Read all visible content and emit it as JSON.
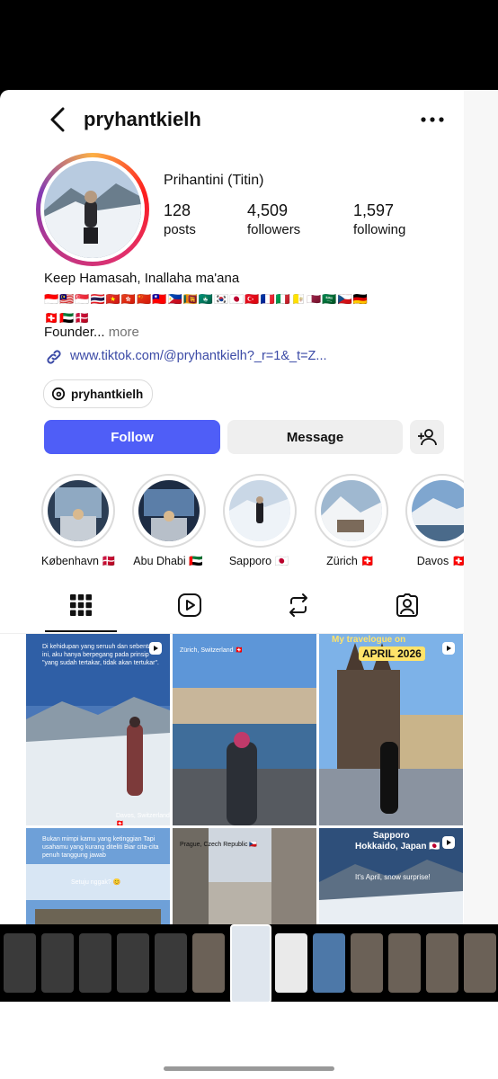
{
  "header": {
    "username": "pryhantkielh"
  },
  "profile": {
    "full_name": "Prihantini (Titin)",
    "stats": [
      {
        "value": "128",
        "label": "posts"
      },
      {
        "value": "4,509",
        "label": "followers"
      },
      {
        "value": "1,597",
        "label": "following"
      }
    ],
    "bio_line": "Keep Hamasah, Inallaha ma'ana",
    "flags_row1": "🇮🇩🇲🇾🇸🇬🇹🇭🇻🇳🇭🇰🇨🇳🇹🇼🇵🇭🇱🇰🇲🇴🇰🇷🇯🇵🇹🇷🇫🇷🇮🇹🇻🇦🇶🇦🇸🇦🇨🇿🇩🇪",
    "flags_row2": "🇨🇭🇦🇪🇩🇰",
    "founder": "Founder...",
    "more": "more",
    "link": "www.tiktok.com/@pryhantkielh?_r=1&_t=Z...",
    "threads_handle": "pryhantkielh"
  },
  "actions": {
    "follow": "Follow",
    "message": "Message"
  },
  "highlights": [
    {
      "label": "København 🇩🇰"
    },
    {
      "label": "Abu Dhabi 🇦🇪"
    },
    {
      "label": "Sapporo 🇯🇵"
    },
    {
      "label": "Zürich 🇨🇭"
    },
    {
      "label": "Davos 🇨🇭"
    }
  ],
  "grid": {
    "post1_text": "Di kehidupan yang seruuh dan sebentar ini, aku hanya berpegang pada prinsip \"yang sudah tertakar, tidak akan tertukar\".",
    "post1_caption": "Davos, Switzerland 🇨🇭",
    "post2_text": "Zürich, Switzerland 🇨🇭",
    "post3_banner": "My travelogue on",
    "post3_date": "APRIL 2026",
    "post4_text": "Bukan mimpi kamu yang ketinggian Tapi usahamu yang kurang diteliti Biar cita-cita penuh tanggung jawab",
    "post4_sub": "Setuju nggak? 😊",
    "post5_text": "Prague, Czech Republic 🇨🇿",
    "post6_title": "Sapporo",
    "post6_sub": "Hokkaido, Japan 🇯🇵",
    "post6_note": "It's April, snow surprise!"
  },
  "colors": {
    "follow_bg": "#4f5ef7",
    "link": "#3b4aa6"
  }
}
